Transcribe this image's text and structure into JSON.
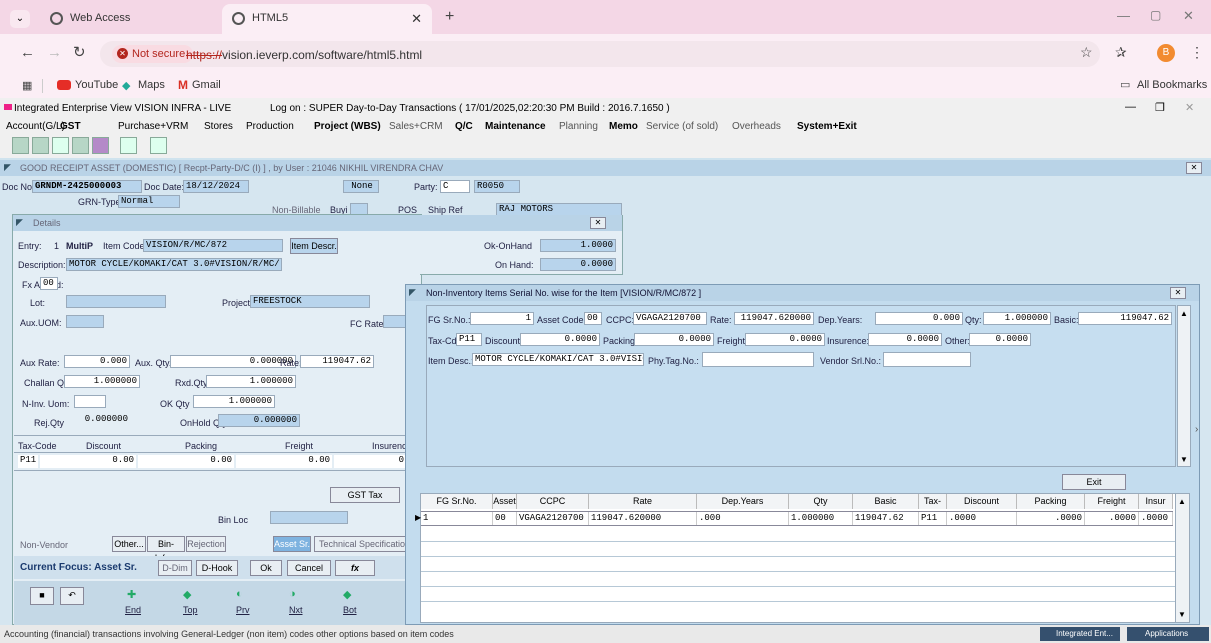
{
  "browser": {
    "tabs": [
      {
        "label": "Web Access"
      },
      {
        "label": "HTML5"
      }
    ],
    "not_secure": "Not secure",
    "url_prefix": "https://",
    "url_rest": "vision.ieverp.com/software/html5.html",
    "bookmarks": [
      "YouTube",
      "Maps",
      "Gmail"
    ],
    "all_bookmarks": "All Bookmarks",
    "profile_initial": "B"
  },
  "app": {
    "title": "Integrated Enterprise View  VISION INFRA - LIVE",
    "session": "Log on : SUPER  Day-to-Day Transactions ( 17/01/2025,02:20:30 PM Build : 2016.7.1650 )",
    "menu": [
      "Account(G/L)",
      "GST",
      "Purchase+VRM",
      "Stores",
      "Production",
      "Project (WBS)",
      "Sales+CRM",
      "Q/C",
      "Maintenance",
      "Planning",
      "Memo",
      "Service (of sold)",
      "Overheads",
      "System+Exit"
    ]
  },
  "main": {
    "title": "GOOD RECEIPT ASSET (DOMESTIC)  [ Recpt-Party-D/C (I) ] , by User : 21046  NIKHIL VIRENDRA CHAV",
    "doc_no_label": "Doc No:",
    "doc_no": "GRNDM-2425000003",
    "doc_date_label": "Doc Date:",
    "doc_date": "18/12/2024",
    "none": "None",
    "party_label": "Party:",
    "party_type": "C",
    "party_code": "R0050",
    "party_name": "RAJ MOTORS",
    "grn_type_label": "GRN-Type",
    "grn_type": "Normal",
    "non_billable": "Non-Billable",
    "buyi": "Buyi",
    "pos": "POS",
    "ship_ref": "Ship Ref"
  },
  "details": {
    "title": "Details",
    "entry_label": "Entry:",
    "entry": "1",
    "multip": "MultiP",
    "item_code_label": "Item Code",
    "item_code": "VISION/R/MC/872",
    "item_descr_btn": "Item Descr.",
    "ok_onhand_label": "Ok-OnHand",
    "ok_onhand": "1.0000",
    "onhand_label": "On Hand:",
    "onhand": "0.0000",
    "description_label": "Description:",
    "description": "MOTOR CYCLE/KOMAKI/CAT 3.0#VISION/R/MC/",
    "fx_label": "Fx Ast Cd:",
    "fx": "00",
    "lot_label": "Lot:",
    "project_label": "Project:",
    "project": "FREESTOCK",
    "aux_uom_label": "Aux.UOM:",
    "fc_rate_label": "FC Rate:",
    "aux_rate_label": "Aux Rate:",
    "aux_rate": "0.000",
    "aux_qty_label": "Aux. Qty.:",
    "aux_qty": "0.000000",
    "rate_label": "Rate:",
    "rate": "119047.62",
    "challan_label": "Challan Qty",
    "challan": "1.000000",
    "rxd_label": "Rxd.Qty",
    "rxd": "1.000000",
    "ninv_label": "N-Inv. Uom:",
    "ok_qty_label": "OK Qty",
    "ok_qty": "1.000000",
    "rej_label": "Rej.Qty",
    "rej": "0.000000",
    "onhold_label": "OnHold Qty",
    "onhold": "0.000000",
    "tax_cols": [
      "Tax-Code",
      "Discount",
      "Packing",
      "Freight",
      "Insurenc"
    ],
    "tax_vals": [
      "P11",
      "0.00",
      "0.00",
      "0.00",
      "0"
    ],
    "gst_btn": "GST Tax",
    "bin_loc": "Bin Loc",
    "non_vendor": "Non-Vendor",
    "other": "Other...",
    "bin_info": "Bin-Info...",
    "rejection": "Rejection",
    "asset_sr": "Asset Sr.",
    "tech_spec": "Technical Specificatio",
    "focus": "Current Focus: Asset Sr.",
    "ddim": "D-Dim",
    "dhook": "D-Hook",
    "ok": "Ok",
    "cancel": "Cancel",
    "fx_btn": "fx",
    "nav": [
      "End",
      "Top",
      "Prv",
      "Nxt",
      "Bot"
    ]
  },
  "serial": {
    "title": "Non-Inventory Items Serial No. wise for the Item [VISION/R/MC/872          ]",
    "fg_label": "FG Sr.No.:",
    "fg": "1",
    "asset_label": "Asset Code:",
    "asset": "00",
    "ccpc_label": "CCPC:",
    "ccpc": "VGAGA2120700",
    "rate_label": "Rate:",
    "rate": "119047.620000",
    "dep_label": "Dep.Years:",
    "dep": "0.000",
    "qty_label": "Qty:",
    "qty": "1.000000",
    "basic_label": "Basic:",
    "basic": "119047.62",
    "taxcd_label": "Tax-Cd",
    "taxcd": "P11",
    "discount_label": "Discount:",
    "discount": "0.0000",
    "packing_label": "Packing:",
    "packing": "0.0000",
    "freight_label": "Freight:",
    "freight": "0.0000",
    "insurance_label": "Insurence:",
    "insurance": "0.0000",
    "other_label": "Other:",
    "other": "0.0000",
    "itemdesc_label": "Item Desc.:",
    "itemdesc": "MOTOR CYCLE/KOMAKI/CAT 3.0#VISION/R/",
    "phy_label": "Phy.Tag.No.:",
    "vendor_label": "Vendor Srl.No.:",
    "exit": "Exit",
    "grid_cols": [
      "FG Sr.No.",
      "Asset",
      "CCPC",
      "Rate",
      "Dep.Years",
      "Qty",
      "Basic",
      "Tax-Cc",
      "Discount",
      "Packing",
      "Freight",
      "Insur"
    ],
    "grid_row": [
      "1",
      "00",
      "VGAGA2120700",
      "119047.620000",
      ".000",
      "1.000000",
      "119047.62",
      "P11",
      ".0000",
      ".0000",
      ".0000",
      ".0000"
    ]
  },
  "status": {
    "text": "Accounting (financial) transactions involving General-Ledger (non item) codes other options based on item codes",
    "task1": "Integrated Ent...",
    "task2": "Applications"
  }
}
